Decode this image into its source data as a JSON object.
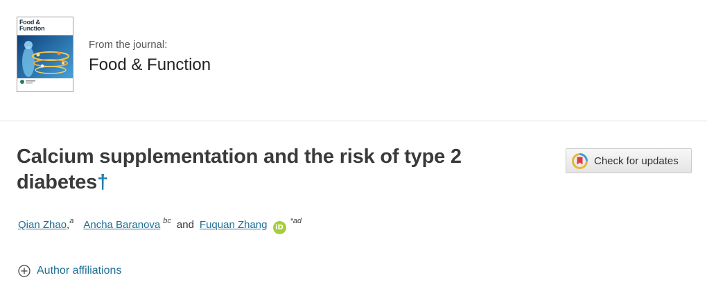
{
  "journal": {
    "cover_title_line1": "Food &",
    "cover_title_line2": "Function",
    "from_label": "From the journal:",
    "name": "Food & Function"
  },
  "article": {
    "title": "Calcium supplementation and the risk of type 2 diabetes",
    "footnote_symbol": "†"
  },
  "updates_button": {
    "label": "Check for updates",
    "icon": "crossmark-icon"
  },
  "authors": [
    {
      "name": "Qian Zhao",
      "affiliations": "a"
    },
    {
      "name": "Ancha Baranova",
      "affiliations": "bc"
    },
    {
      "name": "Fuquan Zhang",
      "affiliations": "*ad",
      "orcid": true
    }
  ],
  "authors_separator": ",",
  "authors_conjunction": "and",
  "orcid_label": "iD",
  "affiliations_toggle": {
    "label": "Author affiliations",
    "icon": "plus-circle-icon"
  },
  "colors": {
    "link": "#1f6f93",
    "dagger": "#1f7db0",
    "orcid": "#a6ce39",
    "title": "#3a3a3a"
  }
}
